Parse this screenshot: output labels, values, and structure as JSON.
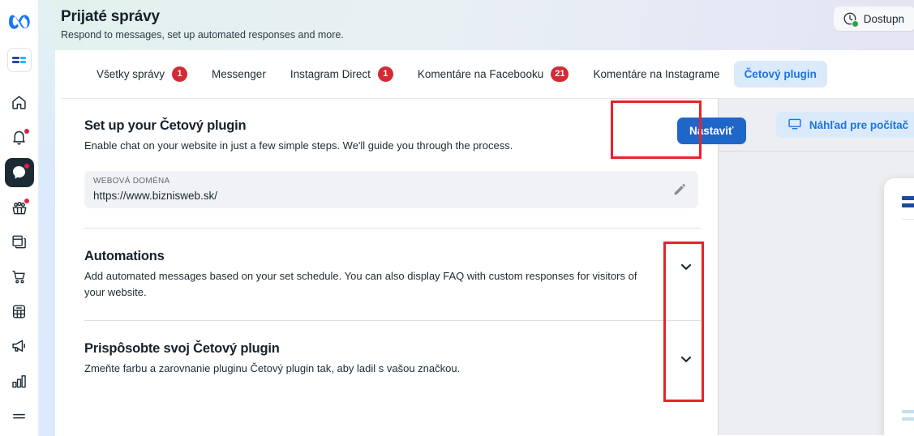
{
  "rail": {
    "logo_icon": "meta-logo-icon",
    "workspace_thumb_alt": "BiznisWeb workspace thumbnail",
    "items": [
      {
        "name": "home",
        "icon": "home-icon",
        "badge": false,
        "active": false
      },
      {
        "name": "notifications",
        "icon": "bell-icon",
        "badge": true,
        "active": false
      },
      {
        "name": "inbox",
        "icon": "chat-bubble-icon",
        "badge": true,
        "active": true
      },
      {
        "name": "audience",
        "icon": "people-group-icon",
        "badge": true,
        "active": false
      },
      {
        "name": "pages",
        "icon": "pages-copy-icon",
        "badge": false,
        "active": false
      },
      {
        "name": "commerce",
        "icon": "shopping-cart-icon",
        "badge": false,
        "active": false
      },
      {
        "name": "catalog",
        "icon": "grid-table-icon",
        "badge": false,
        "active": false
      },
      {
        "name": "ads",
        "icon": "megaphone-icon",
        "badge": false,
        "active": false
      },
      {
        "name": "insights",
        "icon": "bar-chart-icon",
        "badge": false,
        "active": false
      },
      {
        "name": "more",
        "icon": "menu-lines-icon",
        "badge": false,
        "active": false
      }
    ]
  },
  "header": {
    "title": "Prijaté správy",
    "subtitle": "Respond to messages, set up automated responses and more.",
    "availability_label": "Dostupn",
    "availability_icon": "clock-icon",
    "availability_status_color": "#31a24c"
  },
  "tabs": [
    {
      "label": "Všetky správy",
      "badge": "1",
      "active": false
    },
    {
      "label": "Messenger",
      "badge": null,
      "active": false
    },
    {
      "label": "Instagram Direct",
      "badge": "1",
      "active": false
    },
    {
      "label": "Komentáre na Facebooku",
      "badge": "21",
      "active": false
    },
    {
      "label": "Komentáre na Instagrame",
      "badge": null,
      "active": false
    },
    {
      "label": "Četový plugin",
      "badge": null,
      "active": true
    }
  ],
  "setup": {
    "title": "Set up your Četový plugin",
    "subtitle": "Enable chat on your website in just a few simple steps. We'll guide you through the process.",
    "button_label": "Nastaviť",
    "button_color": "#1f66c9",
    "domain_label": "WEBOVÁ DOMÉNA",
    "domain_value": "https://www.biznisweb.sk/",
    "edit_icon": "pencil-icon"
  },
  "automations": {
    "title": "Automations",
    "subtitle": "Add automated messages based on your set schedule. You can also display FAQ with custom responses for visitors of your website.",
    "chevron_icon": "chevron-down-icon"
  },
  "customize": {
    "title": "Prispôsobte svoj Četový plugin",
    "subtitle": "Zmeňte farbu a zarovnanie pluginu Četový plugin tak, aby ladil s vašou značkou.",
    "chevron_icon": "chevron-down-icon"
  },
  "preview": {
    "button_label": "Náhľad pre počítač",
    "button_icon": "monitor-icon"
  },
  "annotations": {
    "accent_color": "#e8222a",
    "boxes": [
      {
        "name": "nastavit-button-highlight"
      },
      {
        "name": "chevrons-highlight"
      }
    ]
  }
}
